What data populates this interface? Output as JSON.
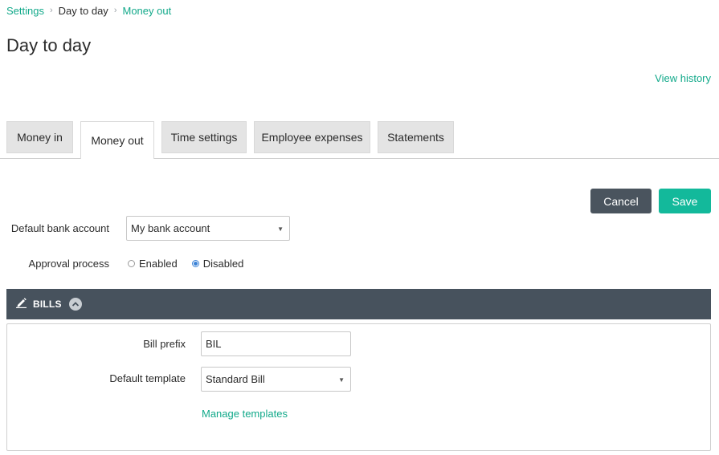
{
  "breadcrumb": {
    "items": [
      {
        "label": "Settings",
        "link": true
      },
      {
        "label": "Day to day",
        "link": false
      },
      {
        "label": "Money out",
        "link": true
      }
    ]
  },
  "page": {
    "title": "Day to day",
    "view_history": "View history"
  },
  "tabs": [
    {
      "label": "Money in",
      "active": false
    },
    {
      "label": "Money out",
      "active": true
    },
    {
      "label": "Time settings",
      "active": false
    },
    {
      "label": "Employee expenses",
      "active": false
    },
    {
      "label": "Statements",
      "active": false
    }
  ],
  "actions": {
    "cancel": "Cancel",
    "save": "Save"
  },
  "form": {
    "default_bank_account": {
      "label": "Default bank account",
      "value": "My bank account"
    },
    "approval_process": {
      "label": "Approval process",
      "options": [
        "Enabled",
        "Disabled"
      ],
      "selected": "Disabled"
    }
  },
  "bills": {
    "title": "BILLS",
    "prefix": {
      "label": "Bill prefix",
      "value": "BIL"
    },
    "template": {
      "label": "Default template",
      "value": "Standard Bill"
    },
    "manage_templates": "Manage templates"
  },
  "colors": {
    "accent": "#12a98a",
    "save": "#13b99b",
    "cancel": "#4a545e",
    "section_header": "#47525d"
  },
  "icons": {
    "breadcrumb_separator": "chevron-right-icon",
    "select_caret": "caret-down-icon",
    "bills_icon": "pencil-edit-icon",
    "collapse": "chevron-up-icon"
  }
}
